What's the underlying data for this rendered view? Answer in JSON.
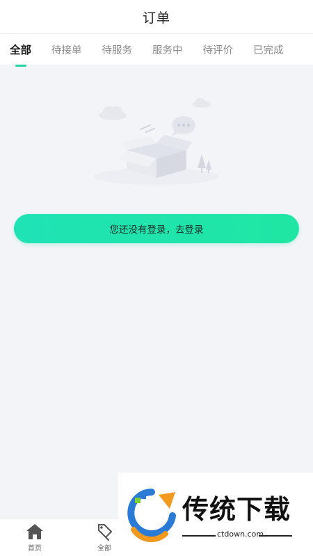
{
  "header": {
    "title": "订单"
  },
  "tabs": [
    {
      "label": "全部",
      "active": true
    },
    {
      "label": "待接单",
      "active": false
    },
    {
      "label": "待服务",
      "active": false
    },
    {
      "label": "服务中",
      "active": false
    },
    {
      "label": "待评价",
      "active": false
    },
    {
      "label": "已完成",
      "active": false
    }
  ],
  "empty_state": {
    "illustration": "empty-box-icon",
    "login_button_label": "您还没有登录，去登录"
  },
  "bottom_nav": {
    "items": [
      {
        "label": "首页",
        "icon": "home-icon"
      },
      {
        "label": "全部",
        "icon": "tag-icon"
      }
    ]
  },
  "watermark": {
    "brand": "传统下载",
    "url": "ctdown.com"
  },
  "colors": {
    "accent": "#22d3a5",
    "button_start": "#1fe3b5",
    "button_end": "#20e6a3",
    "background": "#f3f4f8"
  }
}
